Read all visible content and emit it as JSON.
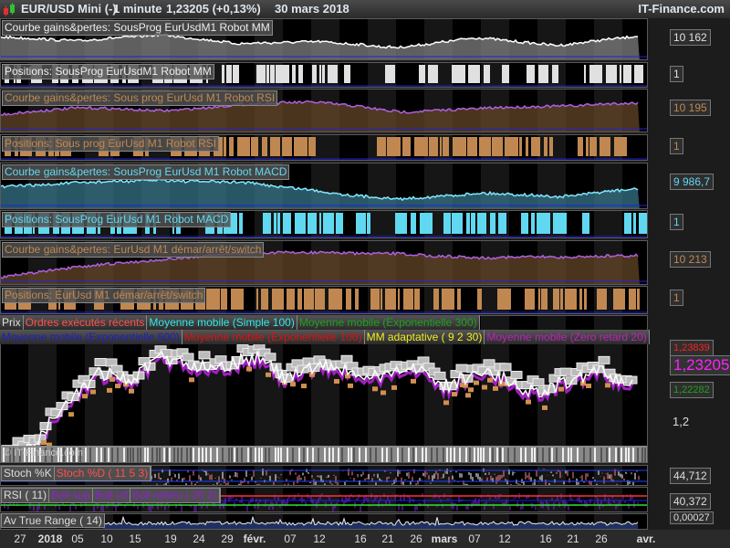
{
  "titlebar": {
    "symbol": "EUR/USD Mini (-)",
    "interval": "1 minute",
    "price": "1,23205 (+0,13%)",
    "date": "30 mars 2018",
    "brand": "IT-Finance.com"
  },
  "panels": [
    {
      "label": "Courbe gains&pertes: SousProg EurUsdM1 Robot MM",
      "value": "10 162",
      "color": "#e0e0e0"
    },
    {
      "label": "Positions: SousProg EurUsdM1 Robot MM",
      "value": "1",
      "color": "#e0e0e0"
    },
    {
      "label": "Courbe gains&pertes: Sous prog EurUsd M1 Robot RSI",
      "value": "10 195",
      "color": "#c08850"
    },
    {
      "label": "Positions: Sous prog EurUsd M1 Robot RSI",
      "value": "1",
      "color": "#c08850"
    },
    {
      "label": "Courbe gains&pertes: SousProg EurUsd M1 Robot MACD",
      "value": "9 986,7",
      "color": "#60d8f0"
    },
    {
      "label": "Positions: SousProg EurUsd M1 Robot MACD",
      "value": "1",
      "color": "#60d8f0"
    },
    {
      "label": "Courbe gains&pertes: EurUsd M1 démar/arrêt/switch",
      "value": "10 213",
      "color": "#c08850"
    },
    {
      "label": "Positions: EurUsd M1 démar/arrêt/switch",
      "value": "1",
      "color": "#c08850"
    }
  ],
  "price_panel": {
    "legend_row1": [
      {
        "text": "Prix",
        "color": "#dddddd"
      },
      {
        "text": "Ordres exécutés récents",
        "color": "#ff5050"
      },
      {
        "text": "Moyenne mobile (Simple 100)",
        "color": "#30e8e8"
      },
      {
        "text": "Moyenne mobile (Exponentielle 300)",
        "color": "#20a020"
      }
    ],
    "legend_row2": [
      {
        "text": "Moyenne mobile (Exponentielle 600)",
        "color": "#2020c0"
      },
      {
        "text": "Moyenne mobile (Exponentielle 100)",
        "color": "#e01010"
      },
      {
        "text": "MM adaptative ( 9 2 30)",
        "color": "#f0f020"
      },
      {
        "text": "Moyenne mobile (Zero retard 20)",
        "color": "#c020c0"
      }
    ],
    "current_price": "1,23205",
    "upper_label": "1,23839",
    "lower_label": "1,22282",
    "axis_tick": "1,2",
    "watermark": "© IT-Finance.com"
  },
  "stoch": {
    "labels": [
      {
        "text": "Stoch %K",
        "color": "#dddddd"
      },
      {
        "text": "Stoch %D ( 11 5 3)",
        "color": "#ff5050"
      }
    ],
    "value": "44,712"
  },
  "rsi": {
    "labels": [
      {
        "text": "RSI ( 11)",
        "color": "#dddddd"
      },
      {
        "text": "Boll sup",
        "color": "#9020d0"
      },
      {
        "text": "Boll inf",
        "color": "#9020d0"
      },
      {
        "text": "Boll milieu ( 20 2)",
        "color": "#9020d0"
      }
    ],
    "value": "40,372"
  },
  "atr": {
    "label": "Av True Range ( 14)",
    "value": "0,00027"
  },
  "date_axis": [
    "27",
    "2018",
    "05",
    "10",
    "15",
    "19",
    "24",
    "29",
    "févr.",
    "07",
    "12",
    "16",
    "21",
    "26",
    "mars",
    "07",
    "12",
    "16",
    "21",
    "26",
    "avr."
  ]
}
